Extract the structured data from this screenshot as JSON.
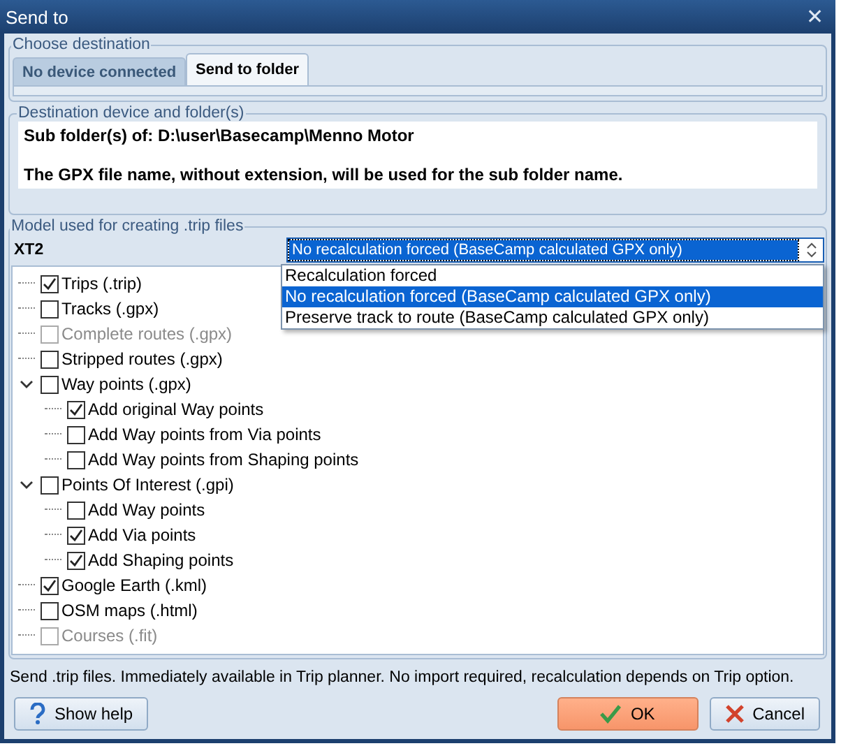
{
  "window": {
    "title": "Send to",
    "close": "✕"
  },
  "destination_group": {
    "legend": "Choose destination",
    "tabs": [
      {
        "label": "No device connected",
        "selected": false
      },
      {
        "label": "Send to folder",
        "selected": true
      }
    ]
  },
  "folder_group": {
    "legend": "Destination device and folder(s)",
    "lines": [
      "Sub folder(s) of: D:\\user\\Basecamp\\Menno Motor",
      "The GPX file name, without extension, will be used for the sub folder name."
    ]
  },
  "model_group": {
    "legend": "Model used for creating .trip files",
    "model": "XT2",
    "select": {
      "value": "No recalculation forced (BaseCamp calculated GPX only)",
      "expanded": true,
      "options": [
        {
          "label": "Recalculation forced",
          "selected": false
        },
        {
          "label": "No recalculation forced (BaseCamp calculated GPX only)",
          "selected": true
        },
        {
          "label": "Preserve track to route (BaseCamp calculated GPX only)",
          "selected": false
        }
      ]
    }
  },
  "tree": [
    {
      "label": "Trips (.trip)",
      "checked": true,
      "disabled": false
    },
    {
      "label": "Tracks (.gpx)",
      "checked": false,
      "disabled": false
    },
    {
      "label": "Complete routes (.gpx)",
      "checked": false,
      "disabled": true
    },
    {
      "label": "Stripped routes (.gpx)",
      "checked": false,
      "disabled": false
    },
    {
      "label": "Way points (.gpx)",
      "checked": false,
      "disabled": false,
      "expanded": true,
      "children": [
        {
          "label": "Add original Way points",
          "checked": true,
          "disabled": false
        },
        {
          "label": "Add Way points from Via points",
          "checked": false,
          "disabled": false
        },
        {
          "label": "Add Way points from Shaping points",
          "checked": false,
          "disabled": false
        }
      ]
    },
    {
      "label": "Points Of Interest (.gpi)",
      "checked": false,
      "disabled": false,
      "expanded": true,
      "children": [
        {
          "label": "Add Way points",
          "checked": false,
          "disabled": false
        },
        {
          "label": "Add Via points",
          "checked": true,
          "disabled": false
        },
        {
          "label": "Add Shaping points",
          "checked": true,
          "disabled": false
        }
      ]
    },
    {
      "label": "Google Earth (.kml)",
      "checked": true,
      "disabled": false
    },
    {
      "label": "OSM maps (.html)",
      "checked": false,
      "disabled": false
    },
    {
      "label": "Courses (.fit)",
      "checked": false,
      "disabled": true
    }
  ],
  "status_text": "Send .trip files. Immediately available in Trip planner. No import required, recalculation depends on Trip option.",
  "buttons": [
    {
      "kind": "help",
      "label": "Show help"
    },
    {
      "kind": "ok",
      "label": "OK"
    },
    {
      "kind": "cancel",
      "label": "Cancel"
    }
  ]
}
